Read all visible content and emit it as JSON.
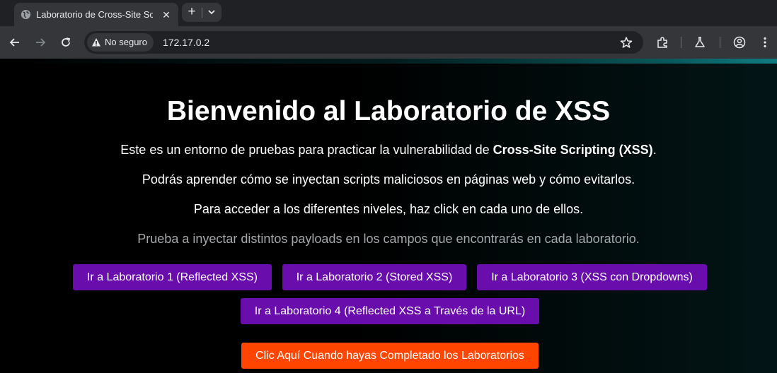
{
  "browser": {
    "tab_title": "Laboratorio de Cross-Site Scripting",
    "security_label": "No seguro",
    "url": "172.17.0.2"
  },
  "page": {
    "heading": "Bienvenido al Laboratorio de XSS",
    "intro_prefix": "Este es un entorno de pruebas para practicar la vulnerabilidad de ",
    "intro_bold": "Cross-Site Scripting (XSS)",
    "intro_suffix": ".",
    "line2": "Podrás aprender cómo se inyectan scripts maliciosos en páginas web y cómo evitarlos.",
    "line3": "Para acceder a los diferentes niveles, haz click en cada uno de ellos.",
    "line4": "Prueba a inyectar distintos payloads en los campos que encontrarás en cada laboratorio.",
    "buttons": [
      "Ir a Laboratorio 1 (Reflected XSS)",
      "Ir a Laboratorio 2 (Stored XSS)",
      "Ir a Laboratorio 3 (XSS con Dropdowns)",
      "Ir a Laboratorio 4 (Reflected XSS a Través de la URL)"
    ],
    "complete_button": "Clic Aquí Cuando hayas Completado los Laboratorios"
  },
  "colors": {
    "lab_button": "#6a0dad",
    "complete_button": "#ff4500",
    "accent_line": "#0f7c80"
  },
  "icons": [
    "globe-icon",
    "close-icon",
    "plus-icon",
    "chevron-down-icon",
    "back-icon",
    "forward-icon",
    "reload-icon",
    "warning-icon",
    "star-icon",
    "extensions-icon",
    "labs-icon",
    "profile-icon",
    "menu-icon"
  ]
}
